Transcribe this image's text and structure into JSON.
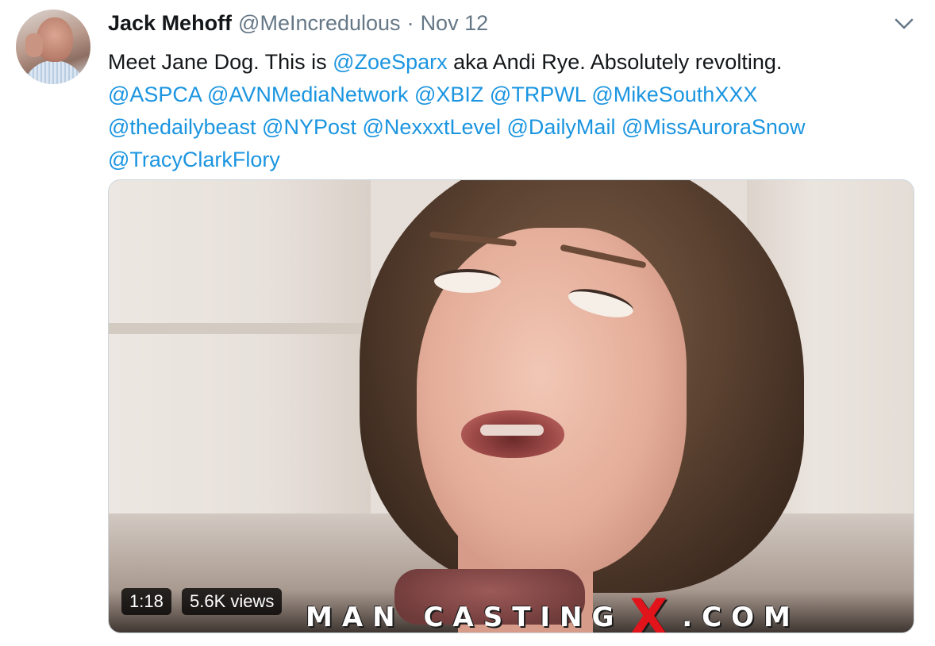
{
  "tweet": {
    "author": {
      "display_name": "Jack Mehoff",
      "handle": "@MeIncredulous"
    },
    "separator": "·",
    "date": "Nov 12",
    "text_lines": [
      [
        {
          "text": "Meet Jane Dog. This is ",
          "mention": false
        },
        {
          "text": "@ZoeSparx",
          "mention": true
        },
        {
          "text": " aka Andi Rye. Absolutely revolting.",
          "mention": false
        }
      ],
      [
        {
          "text": "@ASPCA",
          "mention": true
        },
        {
          "text": " ",
          "mention": false
        },
        {
          "text": "@AVNMediaNetwork",
          "mention": true
        },
        {
          "text": " ",
          "mention": false
        },
        {
          "text": "@XBIZ",
          "mention": true
        },
        {
          "text": " ",
          "mention": false
        },
        {
          "text": "@TRPWL",
          "mention": true
        },
        {
          "text": " ",
          "mention": false
        },
        {
          "text": "@MikeSouthXXX",
          "mention": true
        }
      ],
      [
        {
          "text": "@thedailybeast",
          "mention": true
        },
        {
          "text": " ",
          "mention": false
        },
        {
          "text": "@NYPost",
          "mention": true
        },
        {
          "text": " ",
          "mention": false
        },
        {
          "text": "@NexxxtLevel",
          "mention": true
        },
        {
          "text": " ",
          "mention": false
        },
        {
          "text": "@DailyMail",
          "mention": true
        },
        {
          "text": " ",
          "mention": false
        },
        {
          "text": "@MissAuroraSnow",
          "mention": true
        }
      ],
      [
        {
          "text": "@TracyClarkFlory",
          "mention": true
        }
      ]
    ],
    "menu_icon": "chevron-down-icon",
    "colors": {
      "link": "#1b95e0",
      "secondary": "#657786",
      "text": "#14171a"
    }
  },
  "media": {
    "duration": "1:18",
    "views": "5.6K views",
    "watermark": {
      "before": "MAN CASTING",
      "x": "X",
      "after": ".COM"
    }
  }
}
